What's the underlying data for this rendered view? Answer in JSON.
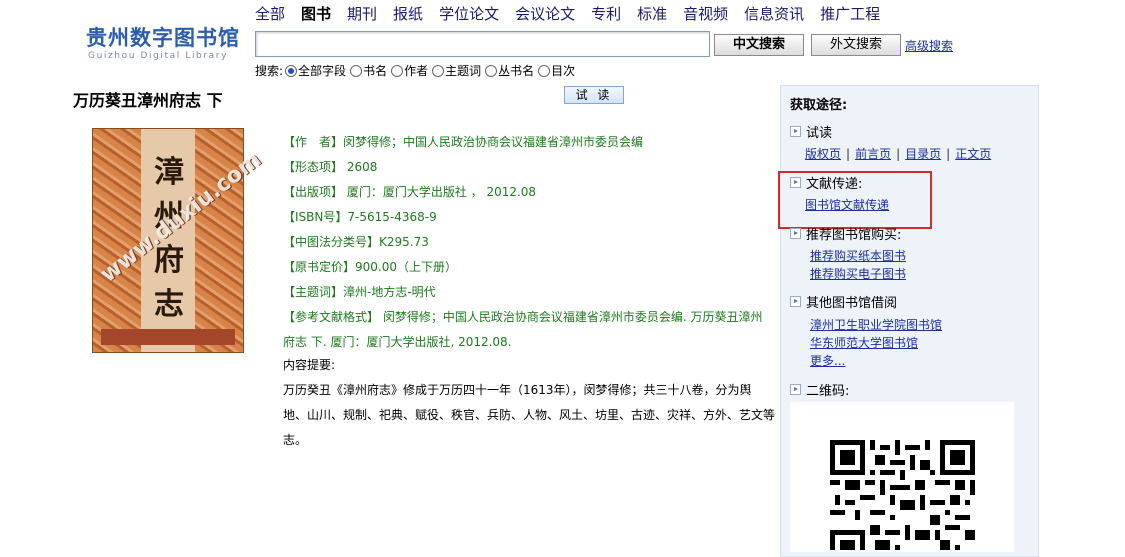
{
  "logo": {
    "cn": "贵州数字图书馆",
    "en": "Guizhou Digital Library"
  },
  "nav": {
    "items": [
      "全部",
      "图书",
      "期刊",
      "报纸",
      "学位论文",
      "会议论文",
      "专利",
      "标准",
      "音视频",
      "信息资讯",
      "推广工程"
    ],
    "active": "图书"
  },
  "search": {
    "value": "",
    "cn_button": "中文搜索",
    "en_button": "外文搜索",
    "advanced": "高级搜索",
    "scope_label": "搜索:",
    "options": [
      "全部字段",
      "书名",
      "作者",
      "主题词",
      "丛书名",
      "目次"
    ],
    "selected": "全部字段"
  },
  "book": {
    "title": "万历葵丑漳州府志 下",
    "trial": "试 读",
    "cover_text": "漳州府志",
    "watermark": "www.duxiu.com",
    "fields": {
      "author": "【作　者】闵梦得修；中国人民政治协商会议福建省漳州市委员会编",
      "pages": "【形态项】 2608",
      "publisher": "【出版项】 厦门：厦门大学出版社 ， 2012.08",
      "isbn": "【ISBN号】7-5615-4368-9",
      "clc": "【中图法分类号】K295.73",
      "price": "【原书定价】900.00（上下册）",
      "subject": "【主题词】漳州-地方志-明代",
      "citation": "【参考文献格式】 闵梦得修；中国人民政治协商会议福建省漳州市委员会编. 万历葵丑漳州府志 下. 厦门：厦门大学出版社, 2012.08."
    },
    "summary_label": "内容提要:",
    "summary": "万历癸丑《漳州府志》修成于万历四十一年（1613年），闵梦得修；共三十八卷，分为舆地、山川、规制、祀典、赋役、秩官、兵防、人物、风土、坊里、古迹、灾祥、方外、艺文等志。"
  },
  "panel": {
    "title": "获取途径:",
    "trial": {
      "label": "试读",
      "links": [
        "版权页",
        "前言页",
        "目录页",
        "正文页"
      ]
    },
    "delivery": {
      "label": "文献传递:",
      "link": "图书馆文献传递"
    },
    "purchase": {
      "label": "推荐图书馆购买:",
      "links": [
        "推荐购买纸本图书",
        "推荐购买电子图书"
      ]
    },
    "other": {
      "label": "其他图书馆借阅",
      "links": [
        "漳州卫生职业学院图书馆",
        "华东师范大学图书馆",
        "更多..."
      ]
    },
    "qr": {
      "label": "二维码:"
    }
  },
  "colors": {
    "field_text": "#1d7a1d",
    "link": "#1a2fa0",
    "highlight": "#d42b2b",
    "panel_bg": "#eef3fa"
  }
}
